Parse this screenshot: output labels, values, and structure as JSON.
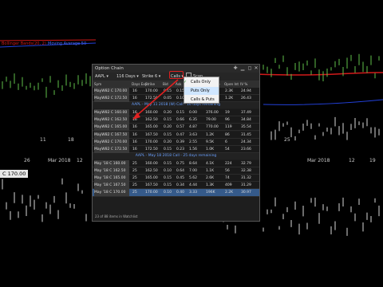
{
  "chart": {
    "legend_red": "Bollinger Bands(20, 2)",
    "legend_blue": "Moving Average 50",
    "date_labels": [
      "11",
      "18",
      "25",
      "Mar 2018",
      "12",
      "19"
    ],
    "date_labels_lower": [
      "26",
      "Mar 2018",
      "12"
    ],
    "price_tag": "C 170.00",
    "colors": {
      "bg": "#000000",
      "red_line": "#d21a1a",
      "blue_line": "#2240d8",
      "candle": "#d8d8d8",
      "green_candle": "#5fbf4a"
    }
  },
  "window": {
    "title": "Option Chain",
    "symbol": "AAPL",
    "expiry": "116 Days",
    "strike": "Strike 6",
    "calls_select": "Calls",
    "scan_label": "Scan"
  },
  "columns": [
    "Sym",
    "Days Exp",
    "Strike",
    "Bid",
    "Ask",
    "Last",
    "Volume",
    "Open Int",
    "IV %"
  ],
  "rows_top": [
    {
      "sym": "MayW82 C 170.00",
      "days": "16",
      "strike": "170.00",
      "c1": "0.15",
      "c2": "0.15",
      "c3": "0.10",
      "c4": "0.55",
      "c5": "2.3K",
      "c6": "24.94"
    },
    {
      "sym": "MayW82 C 172.50",
      "days": "16",
      "strike": "172.50",
      "c1": "0.05",
      "c2": "0.10",
      "c3": "0.05",
      "c4": "0.30",
      "c5": "1.2K",
      "c6": "26.43"
    }
  ],
  "group1": "AAPL - May 11 2018 (W) Call - 16 days remaining",
  "rows_mid": [
    {
      "sym": "MayW82 C 160.00",
      "days": "16",
      "strike": "160.00",
      "c1": "0.20",
      "c2": "0.15",
      "c3": "0.00",
      "c4": "376.00",
      "c5": "19",
      "c6": "37.49"
    },
    {
      "sym": "MayW82 C 162.50",
      "days": "16",
      "strike": "162.50",
      "c1": "0.15",
      "c2": "0.66",
      "c3": "6.35",
      "c4": "79.00",
      "c5": "96",
      "c6": "34.84"
    },
    {
      "sym": "MayW82 C 165.00",
      "days": "16",
      "strike": "165.00",
      "c1": "0.20",
      "c2": "0.57",
      "c3": "4.87",
      "c4": "770.00",
      "c5": "119",
      "c6": "35.54"
    },
    {
      "sym": "MayW82 C 167.50",
      "days": "16",
      "strike": "167.50",
      "c1": "0.15",
      "c2": "0.47",
      "c3": "3.63",
      "c4": "1.2K",
      "c5": "86",
      "c6": "31.45"
    },
    {
      "sym": "MayW82 C 170.00",
      "days": "16",
      "strike": "170.00",
      "c1": "0.20",
      "c2": "0.39",
      "c3": "2.55",
      "c4": "9.5K",
      "c5": "6",
      "c6": "24.34"
    },
    {
      "sym": "MayW82 C 172.50",
      "days": "16",
      "strike": "172.50",
      "c1": "0.15",
      "c2": "0.23",
      "c3": "1.56",
      "c4": "1.0K",
      "c5": "54",
      "c6": "23.66"
    }
  ],
  "group2": "AAPL - May 18 2018 Call - 25 days remaining",
  "rows_bot": [
    {
      "sym": "May '18 C 160.00",
      "days": "25",
      "strike": "160.00",
      "c1": "0.15",
      "c2": "0.75",
      "c3": "8.64",
      "c4": "4.1K",
      "c5": "224",
      "c6": "32.79"
    },
    {
      "sym": "May '18 C 162.50",
      "days": "25",
      "strike": "162.50",
      "c1": "0.10",
      "c2": "0.64",
      "c3": "7.00",
      "c4": "1.1K",
      "c5": "56",
      "c6": "32.38"
    },
    {
      "sym": "May '18 C 165.00",
      "days": "25",
      "strike": "165.00",
      "c1": "0.15",
      "c2": "0.45",
      "c3": "5.62",
      "c4": "2.6K",
      "c5": "74",
      "c6": "31.32"
    },
    {
      "sym": "May '18 C 167.50",
      "days": "25",
      "strike": "167.50",
      "c1": "0.15",
      "c2": "0.34",
      "c3": "4.44",
      "c4": "1.3K",
      "c5": "409",
      "c6": "31.29"
    },
    {
      "sym": "May '18 C 170.00",
      "days": "25",
      "strike": "170.00",
      "c1": "0.10",
      "c2": "0.40",
      "c3": "3.33",
      "c4": "196K",
      "c5": "2.2K",
      "c6": "30.97"
    }
  ],
  "footer": "23 of 88 items in Watchlist",
  "dropdown": {
    "items": [
      "Calls Only",
      "Puts Only",
      "Calls & Puts"
    ],
    "checked_index": 0,
    "highlighted_index": 1
  }
}
